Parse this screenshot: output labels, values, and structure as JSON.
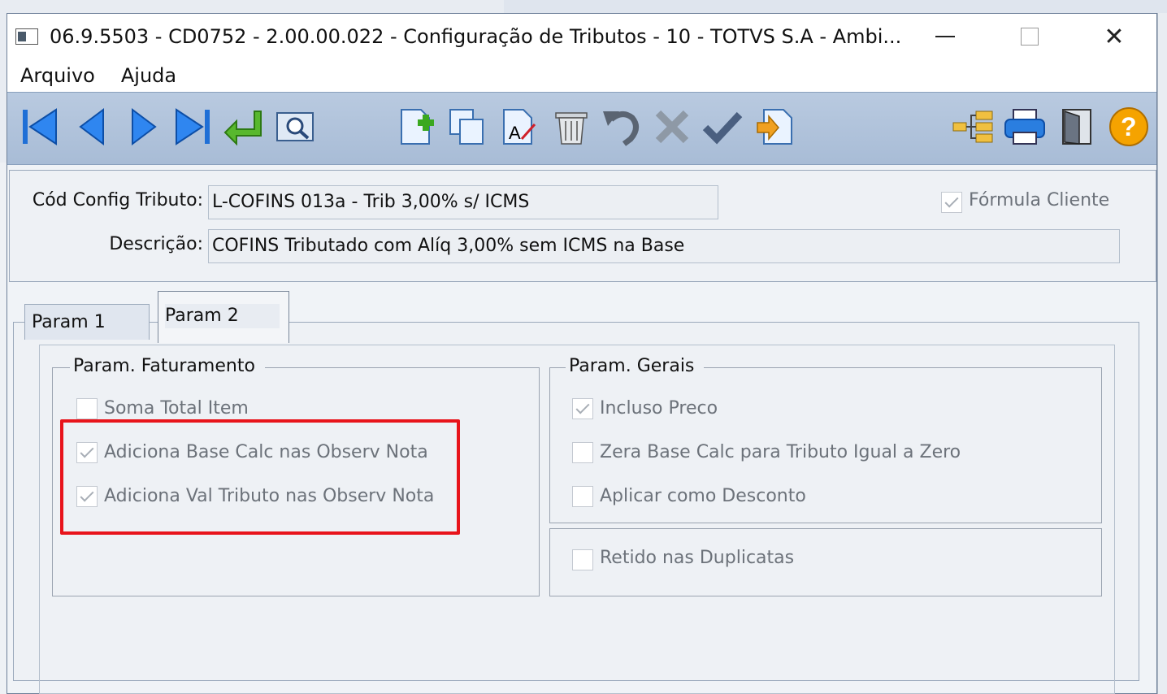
{
  "window": {
    "title": "06.9.5503 - CD0752 - 2.00.00.022 - Configuração de Tributos - 10 - TOTVS S.A - Ambi...",
    "close_glyph": "✕"
  },
  "menu": [
    "Arquivo",
    "Ajuda"
  ],
  "toolbar": {
    "icons": [
      "first-record-icon",
      "previous-record-icon",
      "next-record-icon",
      "last-record-icon",
      "goto-icon",
      "search-icon",
      "new-record-icon",
      "copy-icon",
      "edit-icon",
      "delete-icon",
      "undo-icon",
      "cancel-icon",
      "save-icon",
      "import-icon",
      "structure-icon",
      "print-icon",
      "exit-icon",
      "help-icon"
    ],
    "help_glyph": "?"
  },
  "header": {
    "cod_label": "Cód Config Tributo:",
    "cod_value": "L-COFINS 013a - Trib 3,00% s/ ICMS",
    "desc_label": "Descrição:",
    "desc_value": "COFINS Tributado com Alíq 3,00% sem ICMS na Base",
    "formula_cliente": {
      "label": "Fórmula Cliente",
      "checked": true
    }
  },
  "tabs": [
    {
      "label": "Param 1",
      "active": false
    },
    {
      "label": "Param 2",
      "active": true
    }
  ],
  "param_faturamento": {
    "title": "Param. Faturamento",
    "items": [
      {
        "label": "Soma Total Item",
        "checked": false
      },
      {
        "label": "Adiciona Base Calc nas Observ Nota",
        "checked": true
      },
      {
        "label": "Adiciona Val Tributo nas Observ Nota",
        "checked": true
      }
    ]
  },
  "param_gerais": {
    "title": "Param. Gerais",
    "items": [
      {
        "label": "Incluso Preco",
        "checked": true
      },
      {
        "label": "Zera Base Calc para Tributo Igual a Zero",
        "checked": false
      },
      {
        "label": "Aplicar como Desconto",
        "checked": false
      }
    ]
  },
  "retido": {
    "label": "Retido nas Duplicatas",
    "checked": false
  },
  "colors": {
    "highlight": "#e8141b",
    "toolbar_blue": "#1f6fd6",
    "toolbar_green": "#3a9d1f"
  }
}
